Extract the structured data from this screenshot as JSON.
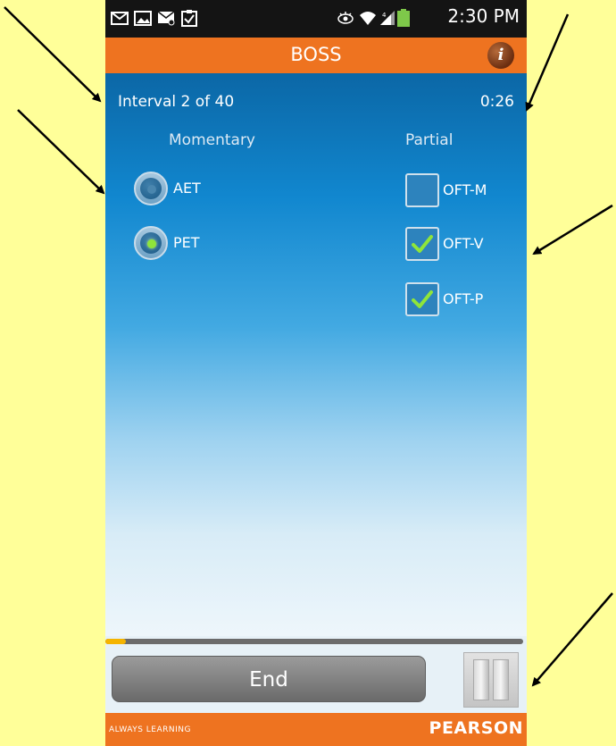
{
  "status_bar": {
    "time": "2:30 PM",
    "icons": [
      "mail-icon",
      "image-icon",
      "message-icon",
      "clipboard-check-icon",
      "eye-icon",
      "wifi-icon",
      "signal-icon",
      "battery-icon"
    ]
  },
  "header": {
    "title": "BOSS",
    "info_icon": "i"
  },
  "session": {
    "interval": "Interval 2 of 40",
    "timer": "0:26"
  },
  "momentary": {
    "heading": "Momentary",
    "options": [
      {
        "label": "AET",
        "selected": false
      },
      {
        "label": "PET",
        "selected": true
      }
    ]
  },
  "partial": {
    "heading": "Partial",
    "options": [
      {
        "label": "OFT-M",
        "checked": false
      },
      {
        "label": "OFT-V",
        "checked": true
      },
      {
        "label": "OFT-P",
        "checked": true
      }
    ]
  },
  "controls": {
    "progress": 0.05,
    "end_label": "End"
  },
  "footer": {
    "tagline": "ALWAYS LEARNING",
    "brand": "PEARSON"
  },
  "colors": {
    "background": "#ffff99",
    "accent_orange": "#ee7320",
    "check_green": "#8fe53a",
    "progress_yellow": "#f5b400"
  }
}
